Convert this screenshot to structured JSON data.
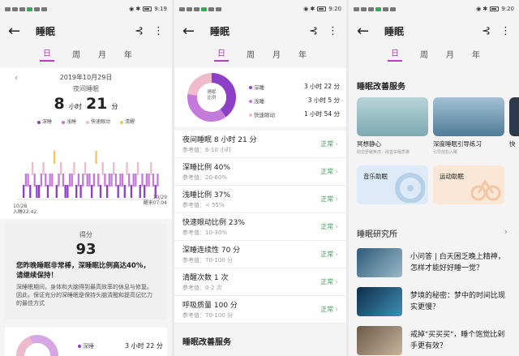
{
  "phone1": {
    "status_time": "9:19",
    "title": "睡眠",
    "tabs": [
      "日",
      "周",
      "月",
      "年"
    ],
    "date": "2019年10月29日",
    "night_label": "夜间睡眠",
    "hours": "8",
    "hours_unit": "小时",
    "minutes": "21",
    "minutes_unit": "分",
    "legend": [
      "深睡",
      "浅睡",
      "快速眼动",
      "清醒"
    ],
    "start_date": "10/28",
    "start_time": "入睡22:42",
    "end_date": "10/29",
    "end_time": "醒来07:04",
    "score_label": "得分",
    "score": "93",
    "summary": "您昨晚睡眠非常棒，深睡眠比例高达40%，请继续保持！",
    "advice": "深睡眠期间，身体和大脑得到最高效率的休息与修复。因此，保证充分的深睡眠是保持头脑清醒和提高记忆力的最佳方式",
    "bottom_item": "深睡",
    "bottom_value": "3 小时 22 分"
  },
  "phone2": {
    "status_time": "9:20",
    "title": "睡眠",
    "tabs": [
      "日",
      "周",
      "月",
      "年"
    ],
    "donut_label_1": "睡眠",
    "donut_label_2": "比例",
    "breakdown": [
      {
        "name": "深睡",
        "value": "3 小时 22 分",
        "color": "#8e3fc8"
      },
      {
        "name": "浅睡",
        "value": "3 小时 5 分",
        "color": "#c47ad9"
      },
      {
        "name": "快速眼动",
        "value": "1 小时 54 分",
        "color": "#eebbcc"
      }
    ],
    "metrics": [
      {
        "title": "夜间睡眠  8 小时 21 分",
        "ref": "参考值：6-10 小时",
        "status": "正常"
      },
      {
        "title": "深睡比例  40%",
        "ref": "参考值：20-60%",
        "status": "正常"
      },
      {
        "title": "浅睡比例  37%",
        "ref": "参考值：< 55%",
        "status": "正常"
      },
      {
        "title": "快速眼动比例  23%",
        "ref": "参考值：10-30%",
        "status": "正常"
      },
      {
        "title": "深睡连续性  70 分",
        "ref": "参考值：70-100 分",
        "status": "正常"
      },
      {
        "title": "清醒次数  1 次",
        "ref": "参考值：0-2 次",
        "status": "正常"
      },
      {
        "title": "呼吸质量  100 分",
        "ref": "参考值：70-100 分",
        "status": "正常"
      }
    ],
    "footer_title": "睡眠改善服务"
  },
  "phone3": {
    "status_time": "9:20",
    "title": "睡眠",
    "tabs": [
      "日",
      "周",
      "月",
      "年"
    ],
    "service_title": "睡眠改善服务",
    "cards": [
      {
        "title": "冥想静心",
        "sub": "助您舒缓焦虑，改善失眠质量"
      },
      {
        "title": "深度睡眠引导练习",
        "sub": "引导放松入眠"
      },
      {
        "title": "快"
      }
    ],
    "cards2": [
      {
        "title": "音乐助眠"
      },
      {
        "title": "运动助眠"
      }
    ],
    "research_title": "睡眠研究所",
    "articles": [
      {
        "title": "小问答 | 白天困乏晚上精神，怎样才能好好睡一觉？"
      },
      {
        "title": "梦境的秘密：梦中的时间比现实更慢？"
      },
      {
        "title": "戒掉\"买买买\"，睡个饱觉比剁手更有效？"
      }
    ]
  }
}
